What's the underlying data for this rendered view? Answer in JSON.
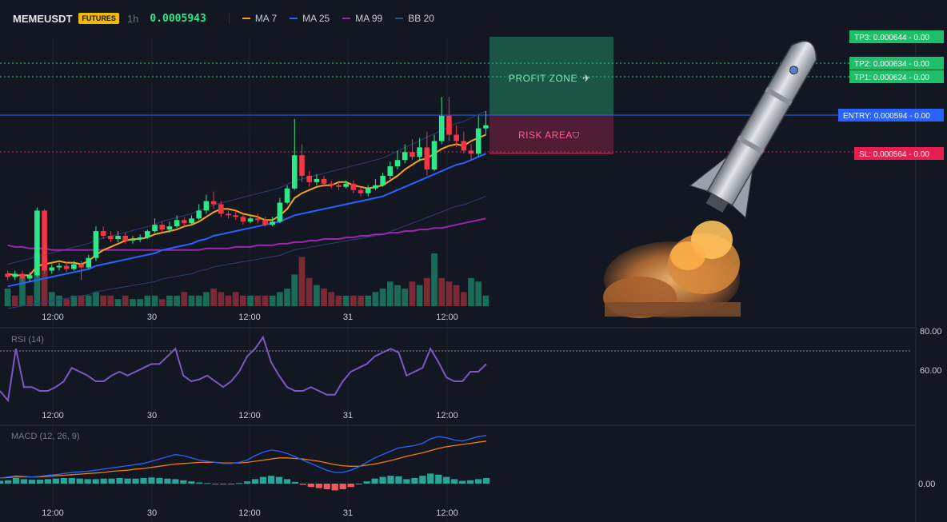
{
  "header": {
    "symbol": "MEMEUSDT",
    "badge": "FUTURES",
    "timeframe": "1h",
    "last_price": "0.0005943",
    "indicators": [
      {
        "name": "MA 7",
        "color": "#f7a21b"
      },
      {
        "name": "MA 25",
        "color": "#2962ff"
      },
      {
        "name": "MA 99",
        "color": "#9c27b0"
      },
      {
        "name": "BB 20",
        "color": "#2a4a9a"
      }
    ]
  },
  "zones": {
    "profit_label": "PROFIT ZONE",
    "risk_label": "RISK AREA"
  },
  "price_tags": [
    {
      "label": "TP3: 0.000644",
      "pnl": "0.00",
      "color": "#1fbf6a"
    },
    {
      "label": "TP2: 0.000634",
      "pnl": "0.00",
      "color": "#1fbf6a"
    },
    {
      "label": "TP1: 0.000624",
      "pnl": "0.00",
      "color": "#1fbf6a"
    },
    {
      "label": "ENTRY: 0.000594",
      "pnl": "0.00",
      "color": "#2962ff"
    },
    {
      "label": "SL: 0.000564",
      "pnl": "0.00",
      "color": "#e91e4f"
    }
  ],
  "time_axis": {
    "labels": [
      "12:00",
      "30",
      "12:00",
      "31",
      "12:00"
    ]
  },
  "rsi": {
    "title": "RSI (14)",
    "levels": [
      "80.00",
      "60.00"
    ],
    "values": [
      50,
      45,
      72,
      52,
      52,
      50,
      50,
      52,
      55,
      62,
      60,
      58,
      55,
      55,
      58,
      60,
      58,
      60,
      62,
      64,
      64,
      68,
      72,
      58,
      55,
      56,
      58,
      55,
      52,
      55,
      60,
      68,
      72,
      78,
      65,
      58,
      52,
      50,
      50,
      52,
      50,
      48,
      48,
      55,
      60,
      62,
      64,
      68,
      70,
      72,
      70,
      58,
      60,
      62,
      72,
      65,
      57,
      55,
      55,
      60,
      60,
      64
    ]
  },
  "macd": {
    "title": "MACD (12, 26, 9)",
    "level": "0.00",
    "macd_line": [
      0.1,
      0.12,
      0.14,
      0.13,
      0.12,
      0.13,
      0.15,
      0.16,
      0.18,
      0.2,
      0.21,
      0.22,
      0.24,
      0.26,
      0.28,
      0.3,
      0.32,
      0.34,
      0.36,
      0.4,
      0.44,
      0.48,
      0.52,
      0.5,
      0.46,
      0.42,
      0.4,
      0.38,
      0.36,
      0.36,
      0.38,
      0.42,
      0.5,
      0.56,
      0.6,
      0.58,
      0.54,
      0.48,
      0.42,
      0.36,
      0.3,
      0.24,
      0.2,
      0.2,
      0.24,
      0.3,
      0.38,
      0.46,
      0.52,
      0.58,
      0.64,
      0.66,
      0.68,
      0.72,
      0.8,
      0.84,
      0.82,
      0.78,
      0.76,
      0.8,
      0.84,
      0.86
    ],
    "signal_line": [
      0.1,
      0.11,
      0.12,
      0.12,
      0.12,
      0.12,
      0.13,
      0.14,
      0.15,
      0.16,
      0.17,
      0.18,
      0.19,
      0.2,
      0.22,
      0.23,
      0.24,
      0.26,
      0.27,
      0.29,
      0.31,
      0.33,
      0.35,
      0.36,
      0.37,
      0.38,
      0.38,
      0.38,
      0.37,
      0.37,
      0.37,
      0.38,
      0.4,
      0.42,
      0.44,
      0.46,
      0.46,
      0.45,
      0.44,
      0.42,
      0.4,
      0.37,
      0.34,
      0.32,
      0.31,
      0.31,
      0.33,
      0.35,
      0.38,
      0.41,
      0.45,
      0.49,
      0.52,
      0.55,
      0.59,
      0.63,
      0.66,
      0.68,
      0.7,
      0.72,
      0.74,
      0.76
    ],
    "histogram": [
      0.05,
      0.06,
      0.1,
      0.08,
      0.07,
      0.07,
      0.08,
      0.09,
      0.1,
      0.1,
      0.09,
      0.08,
      0.08,
      0.09,
      0.09,
      0.1,
      0.09,
      0.09,
      0.1,
      0.11,
      0.1,
      0.09,
      0.08,
      0.06,
      0.04,
      0.02,
      0.01,
      0.0,
      -0.01,
      -0.01,
      0.01,
      0.04,
      0.08,
      0.12,
      0.14,
      0.12,
      0.08,
      0.03,
      -0.02,
      -0.06,
      -0.08,
      -0.1,
      -0.12,
      -0.1,
      -0.06,
      -0.01,
      0.04,
      0.09,
      0.12,
      0.14,
      0.13,
      0.08,
      0.1,
      0.14,
      0.18,
      0.16,
      0.12,
      0.08,
      0.05,
      0.06,
      0.08,
      0.1
    ]
  },
  "chart_data": {
    "type": "candlestick",
    "title": "MEMEUSDT 1h",
    "x_labels": [
      "12:00",
      "30",
      "12:00",
      "31",
      "12:00"
    ],
    "levels": {
      "TP3": 0.000644,
      "TP2": 0.000634,
      "TP1": 0.000624,
      "ENTRY": 0.000594,
      "SL": 0.000564
    },
    "ylim": [
      0.00048,
      0.00065
    ],
    "candles": [
      [
        0.0005,
        0.000498,
        0.000502,
        0.000496
      ],
      [
        0.000498,
        0.0005,
        0.000502,
        0.000496
      ],
      [
        0.0005,
        0.000497,
        0.000502,
        0.000495
      ],
      [
        0.000497,
        0.000499,
        0.000501,
        0.000495
      ],
      [
        0.000499,
        0.00054,
        0.000542,
        0.000498
      ],
      [
        0.00054,
        0.000502,
        0.000541,
        0.0005
      ],
      [
        0.000502,
        0.000504,
        0.000506,
        0.0005
      ],
      [
        0.000504,
        0.000505,
        0.000507,
        0.000502
      ],
      [
        0.000505,
        0.000503,
        0.000507,
        0.000501
      ],
      [
        0.000503,
        0.000506,
        0.000508,
        0.000502
      ],
      [
        0.000506,
        0.000504,
        0.000508,
        0.000496
      ],
      [
        0.000504,
        0.00051,
        0.000512,
        0.000503
      ],
      [
        0.00051,
        0.000527,
        0.00053,
        0.000508
      ],
      [
        0.000527,
        0.000524,
        0.00053,
        0.000522
      ],
      [
        0.000524,
        0.000522,
        0.000527,
        0.00052
      ],
      [
        0.000522,
        0.000524,
        0.000527,
        0.00052
      ],
      [
        0.000524,
        0.000521,
        0.000526,
        0.000519
      ],
      [
        0.000521,
        0.000522,
        0.000524,
        0.000519
      ],
      [
        0.000522,
        0.000523,
        0.000525,
        0.00052
      ],
      [
        0.000523,
        0.000527,
        0.000528,
        0.000522
      ],
      [
        0.000527,
        0.000531,
        0.000535,
        0.000526
      ],
      [
        0.000531,
        0.000528,
        0.000533,
        0.000526
      ],
      [
        0.000528,
        0.00053,
        0.000533,
        0.000526
      ],
      [
        0.00053,
        0.000534,
        0.000537,
        0.000529
      ],
      [
        0.000534,
        0.000532,
        0.000536,
        0.00053
      ],
      [
        0.000532,
        0.000535,
        0.000537,
        0.000531
      ],
      [
        0.000535,
        0.00054,
        0.000544,
        0.000534
      ],
      [
        0.00054,
        0.000546,
        0.00055,
        0.000538
      ],
      [
        0.000546,
        0.000544,
        0.000552,
        0.000541
      ],
      [
        0.000544,
        0.000538,
        0.000546,
        0.000536
      ],
      [
        0.000538,
        0.000537,
        0.00054,
        0.000535
      ],
      [
        0.000537,
        0.000536,
        0.00054,
        0.000534
      ],
      [
        0.000536,
        0.000533,
        0.000538,
        0.000531
      ],
      [
        0.000533,
        0.000535,
        0.000537,
        0.000532
      ],
      [
        0.000535,
        0.000534,
        0.000538,
        0.000532
      ],
      [
        0.000534,
        0.000531,
        0.000536,
        0.00053
      ],
      [
        0.000531,
        0.000533,
        0.000536,
        0.00053
      ],
      [
        0.000533,
        0.000545,
        0.000548,
        0.000532
      ],
      [
        0.000545,
        0.000554,
        0.000556,
        0.000544
      ],
      [
        0.000554,
        0.000575,
        0.000598,
        0.000553
      ],
      [
        0.000575,
        0.000562,
        0.000582,
        0.000558
      ],
      [
        0.000562,
        0.000558,
        0.000565,
        0.000555
      ],
      [
        0.000558,
        0.00056,
        0.000563,
        0.000556
      ],
      [
        0.00056,
        0.000557,
        0.000562,
        0.000555
      ],
      [
        0.000557,
        0.000556,
        0.000559,
        0.000554
      ],
      [
        0.000556,
        0.000555,
        0.000558,
        0.000553
      ],
      [
        0.000555,
        0.000557,
        0.000559,
        0.000554
      ],
      [
        0.000557,
        0.000553,
        0.000559,
        0.000551
      ],
      [
        0.000553,
        0.000551,
        0.000555,
        0.000549
      ],
      [
        0.000551,
        0.000554,
        0.000556,
        0.000549
      ],
      [
        0.000554,
        0.000556,
        0.00056,
        0.000553
      ],
      [
        0.000556,
        0.000562,
        0.000564,
        0.000555
      ],
      [
        0.000562,
        0.000568,
        0.000571,
        0.00056
      ],
      [
        0.000568,
        0.000572,
        0.000578,
        0.000566
      ],
      [
        0.000572,
        0.000577,
        0.000582,
        0.00057
      ],
      [
        0.000577,
        0.000574,
        0.000585,
        0.000572
      ],
      [
        0.000574,
        0.00058,
        0.000586,
        0.000571
      ],
      [
        0.00058,
        0.000566,
        0.00059,
        0.000562
      ],
      [
        0.000566,
        0.000584,
        0.000588,
        0.000565
      ],
      [
        0.000584,
        0.0006,
        0.000612,
        0.000582
      ],
      [
        0.0006,
        0.000588,
        0.000612,
        0.000584
      ],
      [
        0.000588,
        0.000584,
        0.000594,
        0.00058
      ],
      [
        0.000584,
        0.000578,
        0.00059,
        0.000576
      ],
      [
        0.000578,
        0.000576,
        0.000582,
        0.000572
      ],
      [
        0.000576,
        0.000592,
        0.0006,
        0.000574
      ],
      [
        0.000592,
        0.000594,
        0.000603,
        0.000588
      ]
    ],
    "ma7": [
      0.0005,
      0.000499,
      0.000499,
      0.000499,
      0.000505,
      0.000506,
      0.000507,
      0.000508,
      0.000507,
      0.000507,
      0.000506,
      0.000508,
      0.000512,
      0.000515,
      0.000517,
      0.000519,
      0.000521,
      0.000522,
      0.000522,
      0.000523,
      0.000525,
      0.000526,
      0.000527,
      0.000528,
      0.00053,
      0.000531,
      0.000533,
      0.000536,
      0.000539,
      0.000541,
      0.000541,
      0.00054,
      0.000538,
      0.000537,
      0.000536,
      0.000534,
      0.000534,
      0.000537,
      0.000541,
      0.000548,
      0.000551,
      0.000553,
      0.000555,
      0.000556,
      0.000556,
      0.000558,
      0.000558,
      0.000556,
      0.000555,
      0.000554,
      0.000555,
      0.000556,
      0.000559,
      0.000562,
      0.000566,
      0.000569,
      0.000572,
      0.000573,
      0.000576,
      0.000579,
      0.000581,
      0.000582,
      0.000581,
      0.000584,
      0.000586,
      0.000588
    ],
    "ma25": [
      0.000492,
      0.000493,
      0.000494,
      0.000495,
      0.000496,
      0.000497,
      0.000498,
      0.000499,
      0.0005,
      0.000501,
      0.000502,
      0.000503,
      0.000505,
      0.000506,
      0.000507,
      0.000508,
      0.000509,
      0.00051,
      0.000511,
      0.000512,
      0.000513,
      0.000515,
      0.000516,
      0.000517,
      0.000518,
      0.000519,
      0.000521,
      0.000522,
      0.000524,
      0.000525,
      0.000526,
      0.000527,
      0.000528,
      0.000529,
      0.00053,
      0.000531,
      0.000532,
      0.000533,
      0.000535,
      0.000537,
      0.000538,
      0.000539,
      0.00054,
      0.000541,
      0.000542,
      0.000543,
      0.000544,
      0.000545,
      0.000546,
      0.000547,
      0.000548,
      0.000549,
      0.000551,
      0.000553,
      0.000555,
      0.000557,
      0.000559,
      0.000561,
      0.000563,
      0.000565,
      0.000567,
      0.000569,
      0.00057,
      0.000572,
      0.000574,
      0.000576
    ],
    "ma99": [
      0.000518,
      0.000517,
      0.000517,
      0.000516,
      0.000516,
      0.000516,
      0.000515,
      0.000515,
      0.000515,
      0.000515,
      0.000515,
      0.000515,
      0.000515,
      0.000515,
      0.000515,
      0.000515,
      0.000515,
      0.000515,
      0.000515,
      0.000515,
      0.000515,
      0.000515,
      0.000515,
      0.000515,
      0.000515,
      0.000515,
      0.000515,
      0.000516,
      0.000516,
      0.000516,
      0.000516,
      0.000517,
      0.000517,
      0.000517,
      0.000518,
      0.000518,
      0.000518,
      0.000519,
      0.000519,
      0.00052,
      0.00052,
      0.000521,
      0.000521,
      0.000522,
      0.000522,
      0.000522,
      0.000523,
      0.000523,
      0.000524,
      0.000524,
      0.000525,
      0.000525,
      0.000526,
      0.000526,
      0.000527,
      0.000527,
      0.000528,
      0.000528,
      0.000529,
      0.000529,
      0.00053,
      0.000531,
      0.000532,
      0.000533,
      0.000534,
      0.000535
    ],
    "volume": [
      5,
      3,
      8,
      3,
      15,
      14,
      4,
      3,
      2,
      3,
      3,
      3,
      4,
      3,
      3,
      2,
      3,
      2,
      2,
      3,
      3,
      2,
      3,
      3,
      4,
      3,
      3,
      4,
      5,
      4,
      3,
      4,
      3,
      3,
      3,
      3,
      3,
      4,
      5,
      9,
      14,
      8,
      6,
      5,
      4,
      3,
      3,
      3,
      3,
      3,
      4,
      5,
      7,
      6,
      5,
      7,
      6,
      8,
      15,
      8,
      7,
      6,
      4,
      8,
      7,
      3
    ],
    "volume_up": [
      true,
      false,
      true,
      false,
      true,
      false,
      true,
      true,
      false,
      true,
      false,
      true,
      true,
      false,
      false,
      true,
      false,
      true,
      true,
      true,
      true,
      false,
      true,
      true,
      false,
      true,
      true,
      true,
      false,
      false,
      false,
      false,
      false,
      true,
      false,
      false,
      true,
      true,
      true,
      true,
      false,
      false,
      true,
      false,
      false,
      false,
      true,
      false,
      false,
      true,
      true,
      true,
      true,
      true,
      true,
      false,
      true,
      false,
      true,
      false,
      false,
      false,
      false,
      true,
      true,
      true
    ]
  }
}
